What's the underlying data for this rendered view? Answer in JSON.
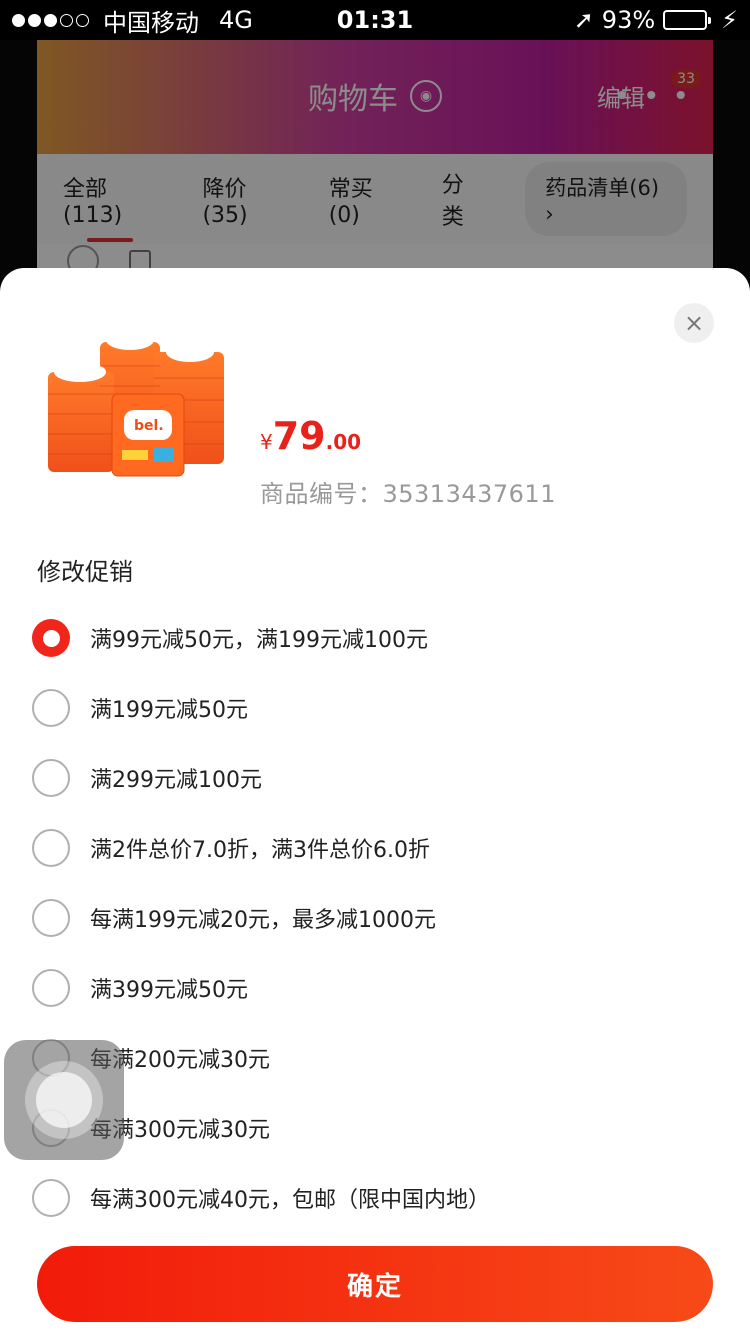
{
  "status_bar": {
    "carrier": "中国移动",
    "network": "4G",
    "time": "01:31",
    "battery": "93%"
  },
  "background_page": {
    "title": "购物车",
    "edit_label": "编辑",
    "more_label": "• • •",
    "badge_count": "33",
    "tabs": [
      "全部(113)",
      "降价(35)",
      "常买(0)",
      "分类"
    ],
    "chip_label": "药品清单(6) ›"
  },
  "sheet": {
    "price_currency": "¥",
    "price_int": "79",
    "price_dec": ".00",
    "sku_label": "商品编号：",
    "sku_value": "35313437611",
    "section_title": "修改促销",
    "close_label": "×",
    "confirm_label": "确定",
    "options": [
      {
        "label": "满99元减50元，满199元减100元",
        "selected": true
      },
      {
        "label": "满199元减50元",
        "selected": false
      },
      {
        "label": "满299元减100元",
        "selected": false
      },
      {
        "label": "满2件总价7.0折，满3件总价6.0折",
        "selected": false
      },
      {
        "label": "每满199元减20元，最多减1000元",
        "selected": false
      },
      {
        "label": "满399元减50元",
        "selected": false
      },
      {
        "label": "每满200元减30元",
        "selected": false
      },
      {
        "label": "每满300元减30元",
        "selected": false
      },
      {
        "label": "每满300元减40元，包邮（限中国内地）",
        "selected": false
      }
    ]
  },
  "product_brand_text": "bel.",
  "colors": {
    "accent": "#f0261a",
    "price": "#e8211a"
  }
}
